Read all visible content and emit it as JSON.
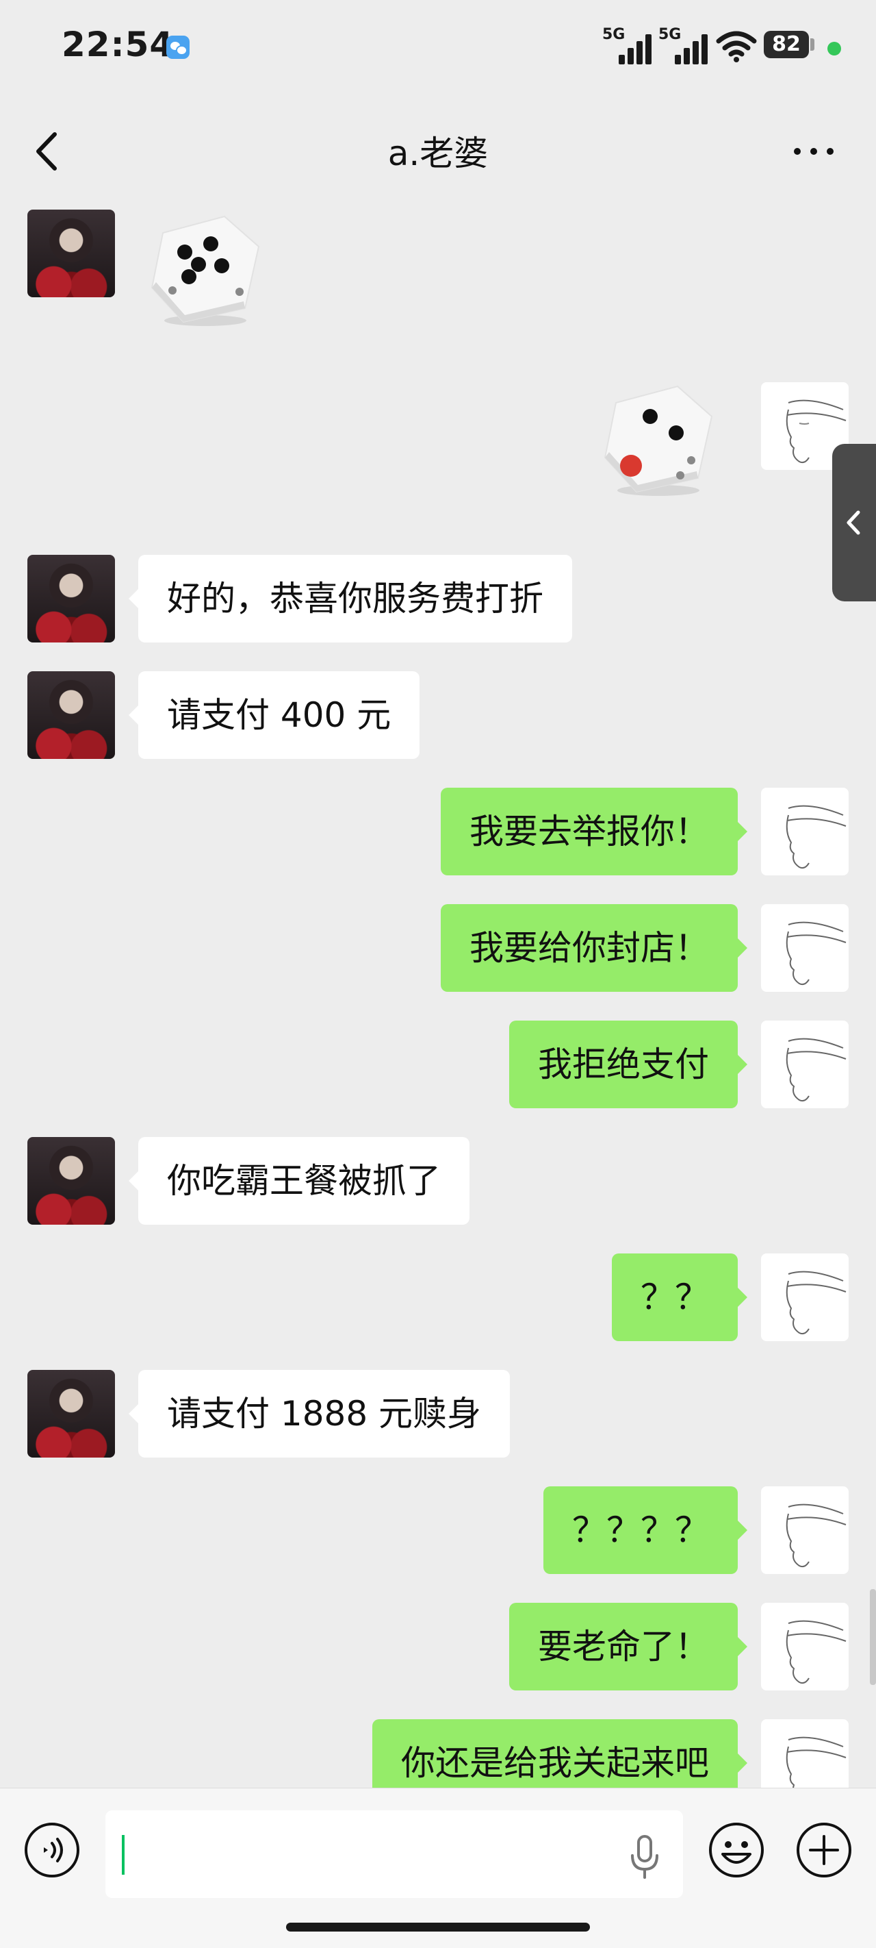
{
  "status_bar": {
    "time": "22:54",
    "signal_1_label": "5G",
    "signal_2_label": "5G",
    "battery": "82"
  },
  "nav": {
    "title": "a.老婆"
  },
  "messages": [
    {
      "side": "in",
      "type": "dice",
      "value": 5
    },
    {
      "side": "out",
      "type": "dice",
      "value": 3
    },
    {
      "side": "in",
      "type": "text",
      "text": "好的，恭喜你服务费打折"
    },
    {
      "side": "in",
      "type": "text",
      "text": "请支付 400 元"
    },
    {
      "side": "out",
      "type": "text",
      "text": "我要去举报你！"
    },
    {
      "side": "out",
      "type": "text",
      "text": "我要给你封店！"
    },
    {
      "side": "out",
      "type": "text",
      "text": "我拒绝支付"
    },
    {
      "side": "in",
      "type": "text",
      "text": "你吃霸王餐被抓了"
    },
    {
      "side": "out",
      "type": "text",
      "text": "？？"
    },
    {
      "side": "in",
      "type": "text",
      "text": "请支付 1888 元赎身"
    },
    {
      "side": "out",
      "type": "text",
      "text": "？？？？"
    },
    {
      "side": "out",
      "type": "text",
      "text": "要老命了！"
    },
    {
      "side": "out",
      "type": "text",
      "text": "你还是给我关起来吧"
    }
  ],
  "input": {
    "value": "",
    "placeholder": ""
  },
  "icons": {
    "back": "chevron-left-icon",
    "more": "ellipsis-icon",
    "side_tab": "chevron-left-icon",
    "voice": "voice-icon",
    "mic": "microphone-icon",
    "emoji": "emoji-icon",
    "plus": "plus-icon"
  },
  "colors": {
    "background": "#ededed",
    "bubble_out": "#95ec69",
    "bubble_in": "#ffffff",
    "cursor": "#07c160"
  }
}
